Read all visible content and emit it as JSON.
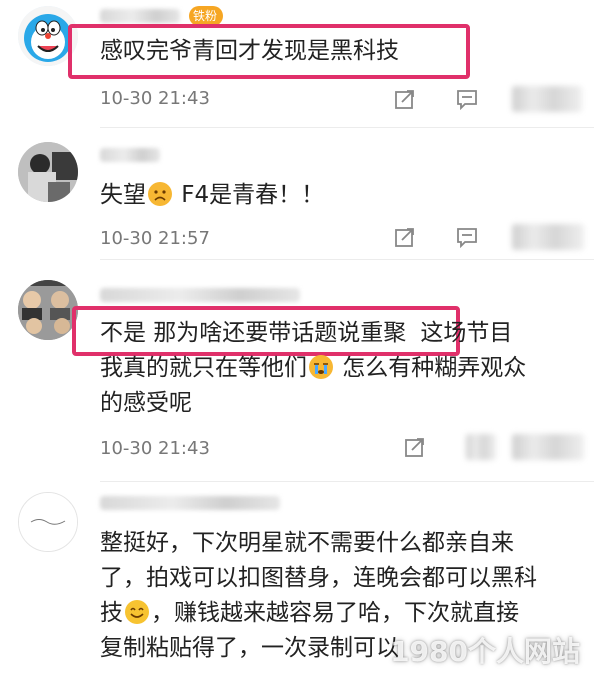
{
  "comments": [
    {
      "badge": "铁粉",
      "text": "感叹完爷青回才发现是黑科技",
      "time": "10-30 21:43"
    },
    {
      "text_before": "失望",
      "text_after": " F4是青春！！",
      "time": "10-30 21:57"
    },
    {
      "line1a": "不是  那为啥还要带话题说重聚",
      "line1b": "这场节目",
      "line2a": "我真的就只在等他们",
      "line2b": " 怎么有种糊弄观众",
      "line3": "的感受呢",
      "time": "10-30 21:43"
    },
    {
      "line1": "整挺好，下次明星就不需要什么都亲自来",
      "line2": "了，拍戏可以扣图替身，连晚会都可以黑科",
      "line3a": "技",
      "line3b": "，赚钱越来越容易了哈，下次就直接",
      "line4": "复制粘贴得了，一次录制可以"
    }
  ],
  "watermark": "1980个人网站",
  "colors": {
    "highlight": "#e0306a",
    "meta": "#777777",
    "badge": "#f6a623"
  },
  "icons": [
    "forward-icon",
    "comment-icon"
  ]
}
